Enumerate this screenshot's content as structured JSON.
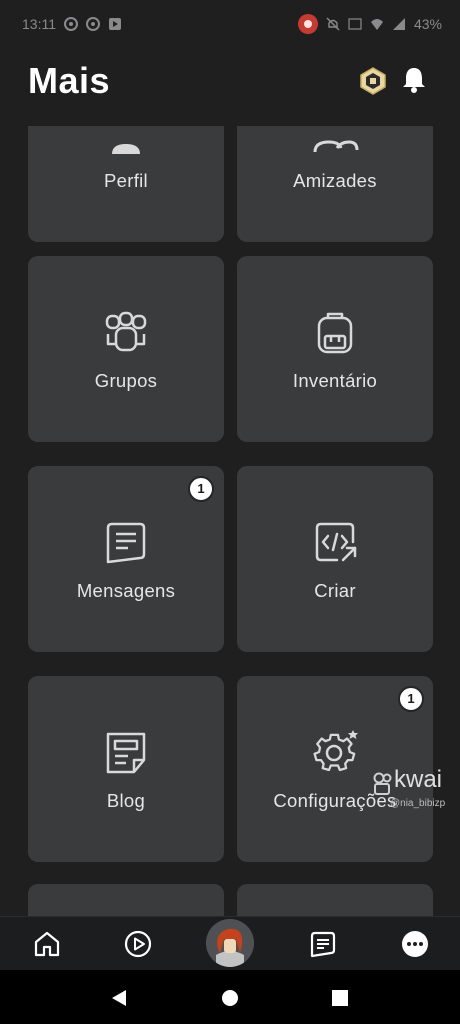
{
  "status_bar": {
    "time": "13:11",
    "battery": "43%"
  },
  "header": {
    "title": "Mais"
  },
  "tiles": [
    {
      "label": "Perfil"
    },
    {
      "label": "Amizades"
    },
    {
      "label": "Grupos"
    },
    {
      "label": "Inventário"
    },
    {
      "label": "Mensagens",
      "badge": "1"
    },
    {
      "label": "Criar"
    },
    {
      "label": "Blog"
    },
    {
      "label": "Configurações",
      "badge": "1"
    }
  ],
  "watermark": {
    "brand": "kwai",
    "user": "@nia_bibizp"
  },
  "bottom_nav": {
    "items": [
      {
        "icon": "home-icon"
      },
      {
        "icon": "play-circle-icon"
      },
      {
        "icon": "avatar"
      },
      {
        "icon": "chat-icon"
      },
      {
        "icon": "more-icon"
      }
    ]
  },
  "colors": {
    "background": "#1f1f20",
    "tile": "#393b3d",
    "text": "#e7e7e8"
  }
}
